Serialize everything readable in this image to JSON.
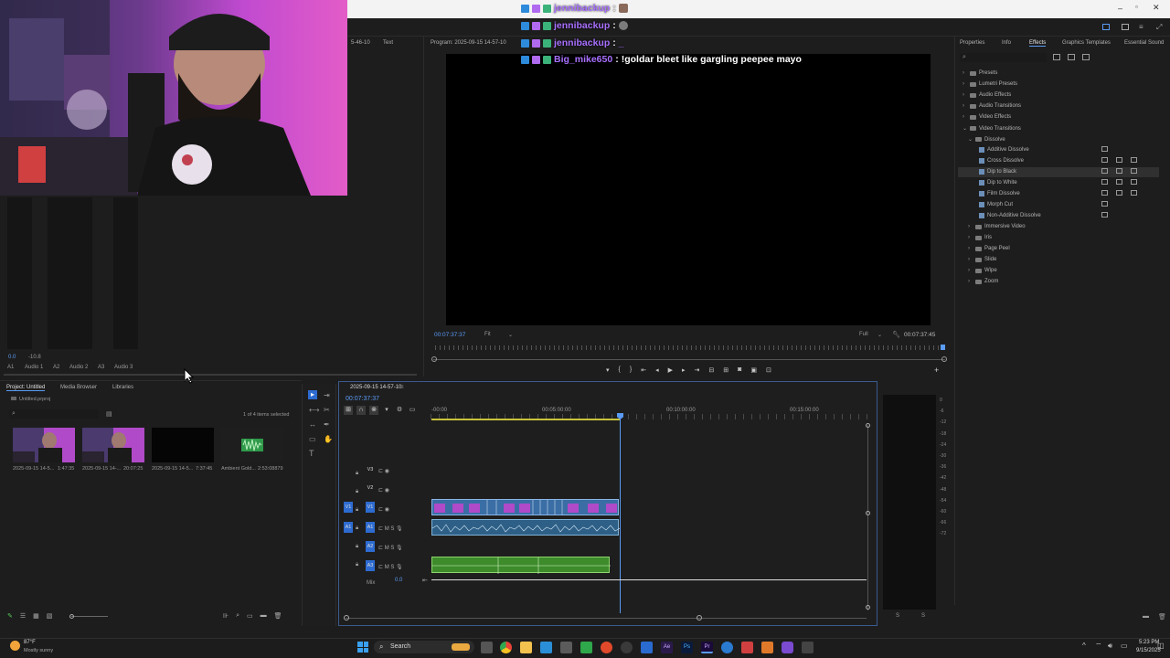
{
  "chat": [
    {
      "user": "jennibackup",
      "message": "",
      "colon": ":"
    },
    {
      "user": "jennibackup",
      "message": "",
      "colon": ":"
    },
    {
      "user": "jennibackup",
      "message": "_",
      "colon": ":"
    },
    {
      "user": "Big_mike650",
      "message": "!goldar bleet like gargling peepee mayo",
      "colon": ":"
    }
  ],
  "source_panel": {
    "tab_partial": "5-46-10",
    "tab_text": "Text"
  },
  "audio_mixer": {
    "readouts": [
      "0.0",
      "-10.8"
    ],
    "channels": [
      "A1",
      "Audio 1",
      "A2",
      "Audio 2",
      "A3",
      "Audio 3"
    ]
  },
  "program": {
    "title": "Program: 2025-09-15 14-57-10",
    "timecode_left": "00:07:37:37",
    "fit_label": "Fit",
    "quality_label": "Full",
    "timecode_right": "00:07:37:45"
  },
  "effects_panel": {
    "tabs": [
      "Properties",
      "Info",
      "Effects",
      "Graphics Templates",
      "Essential Sound"
    ],
    "tree": [
      {
        "label": "Presets",
        "level": 0,
        "open": false
      },
      {
        "label": "Lumetri Presets",
        "level": 0,
        "open": false
      },
      {
        "label": "Audio Effects",
        "level": 0,
        "open": false
      },
      {
        "label": "Audio Transitions",
        "level": 0,
        "open": false
      },
      {
        "label": "Video Effects",
        "level": 0,
        "open": false
      },
      {
        "label": "Video Transitions",
        "level": 0,
        "open": true
      },
      {
        "label": "Dissolve",
        "level": 1,
        "open": true
      },
      {
        "label": "Additive Dissolve",
        "level": 2
      },
      {
        "label": "Cross Dissolve",
        "level": 2
      },
      {
        "label": "Dip to Black",
        "level": 2,
        "selected": true
      },
      {
        "label": "Dip to White",
        "level": 2
      },
      {
        "label": "Film Dissolve",
        "level": 2
      },
      {
        "label": "Morph Cut",
        "level": 2
      },
      {
        "label": "Non-Additive Dissolve",
        "level": 2
      },
      {
        "label": "Immersive Video",
        "level": 1,
        "open": false
      },
      {
        "label": "Iris",
        "level": 1,
        "open": false
      },
      {
        "label": "Page Peel",
        "level": 1,
        "open": false
      },
      {
        "label": "Slide",
        "level": 1,
        "open": false
      },
      {
        "label": "Wipe",
        "level": 1,
        "open": false
      },
      {
        "label": "Zoom",
        "level": 1,
        "open": false
      }
    ]
  },
  "project_panel": {
    "tabs": [
      "Project: Untitled",
      "Media Browser",
      "Libraries"
    ],
    "project_file": "Untitled.prproj",
    "selection_status": "1 of 4 items selected",
    "items": [
      {
        "name": "2025-09-15 14-5...",
        "duration": "1:47:35"
      },
      {
        "name": "2025-09-15 14-...",
        "duration": "20:07:25"
      },
      {
        "name": "2025-09-15 14-5...",
        "duration": "7:37:45"
      },
      {
        "name": "Ambient Gold...",
        "duration": "2:53:08879"
      }
    ]
  },
  "timeline": {
    "sequence_name": "2025-09-15 14-57-10",
    "timecode": "00:07:37:37",
    "ruler": [
      "-00:00",
      "00:05:00:00",
      "00:10:00:00",
      "00:15:00:00"
    ],
    "video_tracks": [
      "V3",
      "V2",
      "V1"
    ],
    "audio_tracks": [
      "A1",
      "A2",
      "A3"
    ],
    "mix_label": "Mix",
    "mix_value": "0.0"
  },
  "taskbar": {
    "weather_temp": "87°F",
    "weather_desc": "Mostly sunny",
    "search_label": "Search",
    "time": "5:23 PM",
    "date": "9/15/2025"
  },
  "colors": {
    "accent_blue": "#2d6bd0",
    "chat_user": "#a970ff",
    "music_clip": "#3d8b2b",
    "video_clip": "#3a6ea5"
  }
}
